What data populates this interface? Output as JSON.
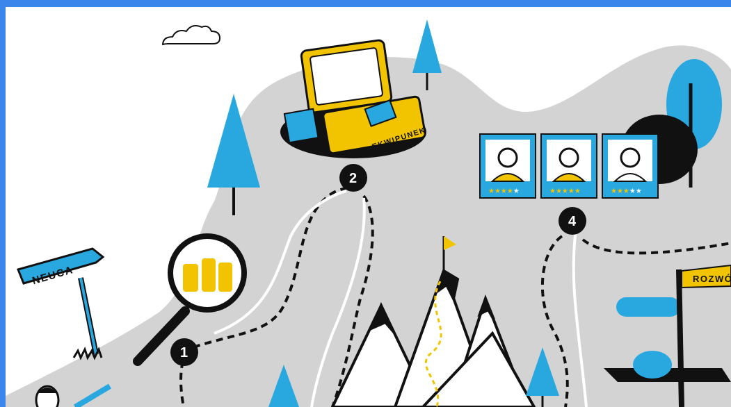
{
  "signs": {
    "left": "NEUCA",
    "right": "ROZWÓJ"
  },
  "suitcase_label": "EKWIPUNEK",
  "steps": [
    "1",
    "2",
    "4"
  ],
  "profiles": [
    {
      "rating": 4
    },
    {
      "rating": 5
    },
    {
      "rating": 3
    }
  ],
  "colors": {
    "frame": "#3a86ea",
    "tree": "#29a8e0",
    "accent": "#f2c400",
    "path": "#d3d3d3",
    "ink": "#111111"
  }
}
